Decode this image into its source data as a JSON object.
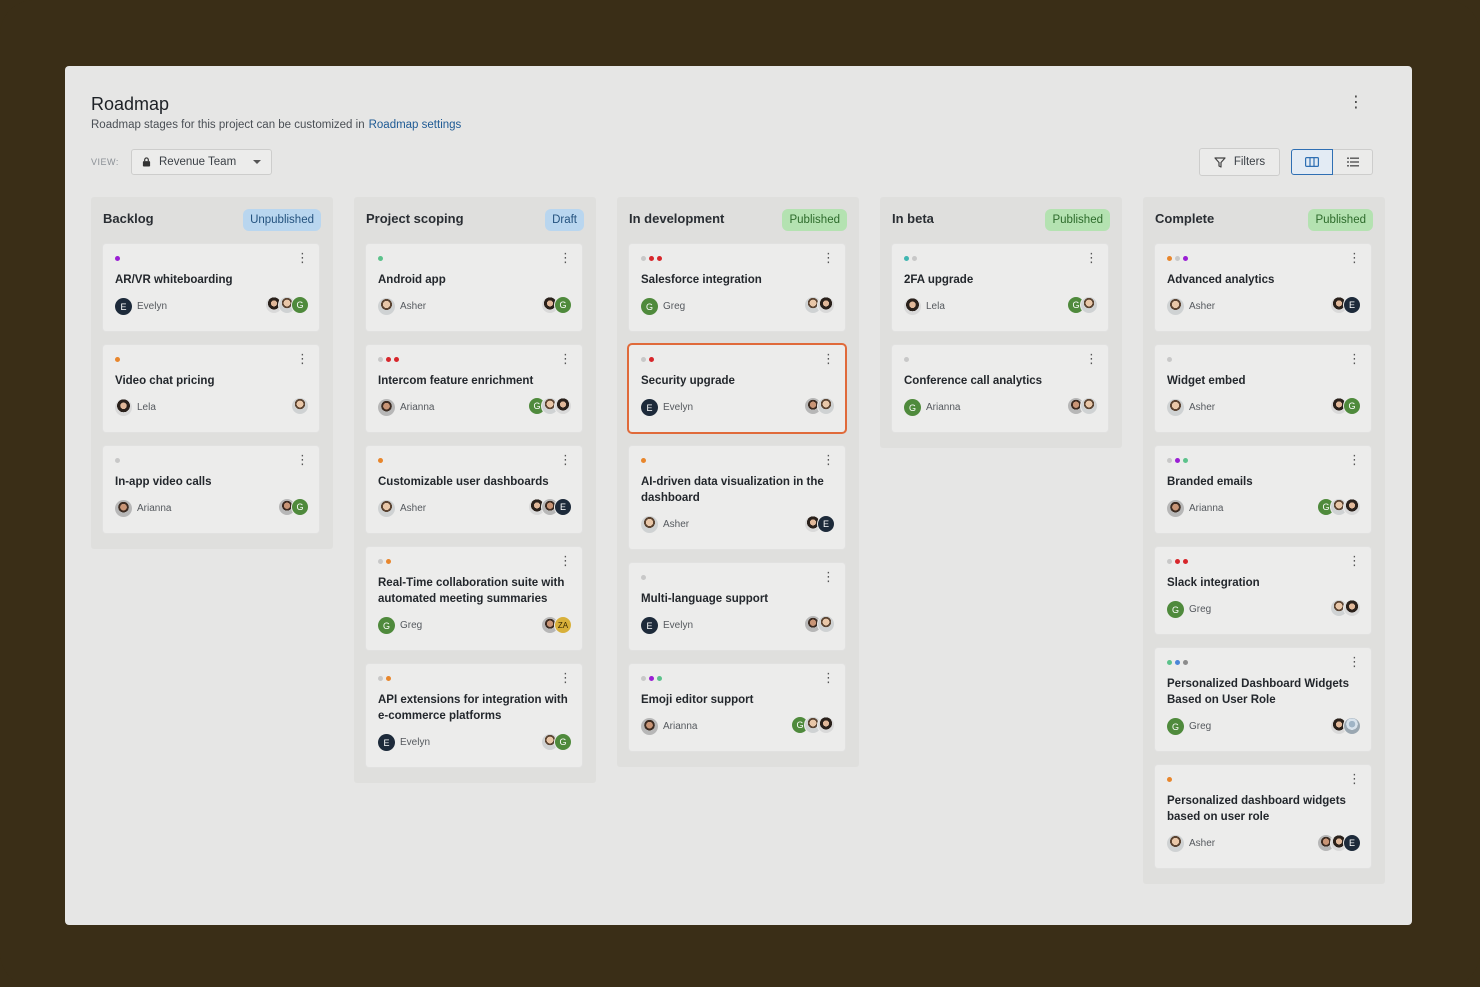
{
  "header": {
    "title": "Roadmap",
    "subtitle": "Roadmap stages for this project can be customized in",
    "settings_link": "Roadmap settings"
  },
  "toolbar": {
    "view_label": "VIEW:",
    "view_value": "Revenue Team",
    "filters_label": "Filters"
  },
  "icons": {
    "more": "vertical-ellipsis-icon",
    "lock": "lock-icon",
    "filter": "funnel-icon",
    "board": "columns-icon",
    "list": "list-icon"
  },
  "colors": {
    "purple": "#9a1fd4",
    "orange": "#e8862c",
    "gray": "#c8c8c8",
    "red": "#d7262b",
    "green": "#5cc28b",
    "teal": "#40b6b1",
    "blue": "#4a86d8",
    "mid": "#8c8c8c",
    "selected_border": "#e06a3a"
  },
  "columns": [
    {
      "title": "Backlog",
      "status": "Unpublished",
      "cards": [
        {
          "title": "AR/VR whiteboarding",
          "dots": [
            "purple"
          ],
          "owner": "Evelyn",
          "owner_avatar": "E",
          "team": [
            "p2",
            "p1",
            "G"
          ]
        },
        {
          "title": "Video chat pricing",
          "dots": [
            "orange"
          ],
          "owner": "Lela",
          "owner_avatar": "p2",
          "team": [
            "p1"
          ]
        },
        {
          "title": "In-app video calls",
          "dots": [
            "gray"
          ],
          "owner": "Arianna",
          "owner_avatar": "p3",
          "team": [
            "p3",
            "G"
          ]
        }
      ]
    },
    {
      "title": "Project scoping",
      "status": "Draft",
      "cards": [
        {
          "title": "Android app",
          "dots": [
            "green"
          ],
          "owner": "Asher",
          "owner_avatar": "p1",
          "team": [
            "p2",
            "G"
          ]
        },
        {
          "title": "Intercom feature enrichment",
          "dots": [
            "gray",
            "red",
            "red"
          ],
          "owner": "Arianna",
          "owner_avatar": "p3",
          "team": [
            "G",
            "p1",
            "p2"
          ]
        },
        {
          "title": "Customizable user dashboards",
          "dots": [
            "orange"
          ],
          "owner": "Asher",
          "owner_avatar": "p1",
          "team": [
            "p2",
            "p3",
            "E"
          ]
        },
        {
          "title": "Real-Time collaboration suite with automated meeting summaries",
          "dots": [
            "gray",
            "orange"
          ],
          "owner": "Greg",
          "owner_avatar": "G",
          "team": [
            "p3",
            "ZA"
          ]
        },
        {
          "title": "API extensions for integration with e-commerce platforms",
          "dots": [
            "gray",
            "orange"
          ],
          "owner": "Evelyn",
          "owner_avatar": "E",
          "team": [
            "p1",
            "G"
          ]
        }
      ]
    },
    {
      "title": "In development",
      "status": "Published",
      "cards": [
        {
          "title": "Salesforce integration",
          "dots": [
            "gray",
            "red",
            "red"
          ],
          "owner": "Greg",
          "owner_avatar": "G",
          "team": [
            "p1",
            "p2"
          ]
        },
        {
          "title": "Security upgrade",
          "dots": [
            "gray",
            "red"
          ],
          "owner": "Evelyn",
          "owner_avatar": "E",
          "team": [
            "p3",
            "p1"
          ],
          "selected": true
        },
        {
          "title": "AI-driven data visualization in the dashboard",
          "dots": [
            "orange"
          ],
          "owner": "Asher",
          "owner_avatar": "p1",
          "team": [
            "p2",
            "E"
          ]
        },
        {
          "title": "Multi-language support",
          "dots": [
            "gray"
          ],
          "owner": "Evelyn",
          "owner_avatar": "E",
          "team": [
            "p3",
            "p1"
          ]
        },
        {
          "title": "Emoji editor support",
          "dots": [
            "gray",
            "purple",
            "green"
          ],
          "owner": "Arianna",
          "owner_avatar": "p3",
          "team": [
            "G",
            "p1",
            "p2"
          ]
        }
      ]
    },
    {
      "title": "In beta",
      "status": "Published",
      "cards": [
        {
          "title": "2FA upgrade",
          "dots": [
            "teal",
            "gray"
          ],
          "owner": "Lela",
          "owner_avatar": "p2",
          "team": [
            "G",
            "p1"
          ]
        },
        {
          "title": "Conference call analytics",
          "dots": [
            "gray"
          ],
          "owner": "Arianna",
          "owner_avatar": "G",
          "team": [
            "p3",
            "p1"
          ]
        }
      ]
    },
    {
      "title": "Complete",
      "status": "Published",
      "cards": [
        {
          "title": "Advanced analytics",
          "dots": [
            "orange",
            "gray",
            "purple"
          ],
          "owner": "Asher",
          "owner_avatar": "p1",
          "team": [
            "p2",
            "E"
          ]
        },
        {
          "title": "Widget embed",
          "dots": [
            "gray"
          ],
          "owner": "Asher",
          "owner_avatar": "p1",
          "team": [
            "p2",
            "G"
          ]
        },
        {
          "title": "Branded emails",
          "dots": [
            "gray",
            "purple",
            "green"
          ],
          "owner": "Arianna",
          "owner_avatar": "p3",
          "team": [
            "G",
            "p1",
            "p2"
          ]
        },
        {
          "title": "Slack integration",
          "dots": [
            "gray",
            "red",
            "red"
          ],
          "owner": "Greg",
          "owner_avatar": "G",
          "team": [
            "p1",
            "p2"
          ]
        },
        {
          "title": "Personalized Dashboard Widgets Based on User Role",
          "dots": [
            "green",
            "blue",
            "mid"
          ],
          "owner": "Greg",
          "owner_avatar": "G",
          "team": [
            "p2",
            "p4"
          ]
        },
        {
          "title": "Personalized dashboard widgets based on user role",
          "dots": [
            "orange"
          ],
          "owner": "Asher",
          "owner_avatar": "p1",
          "team": [
            "p3",
            "p2",
            "E"
          ]
        }
      ]
    }
  ]
}
